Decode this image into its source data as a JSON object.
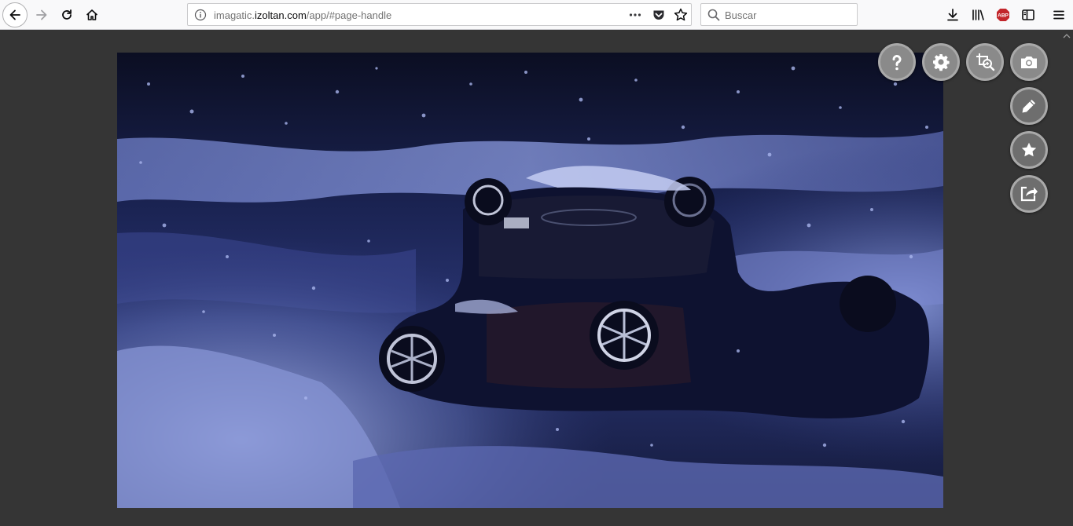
{
  "browser": {
    "url_prefix": "imagatic.",
    "url_domain": "izoltan.com",
    "url_path": "/app/#page-handle",
    "search_placeholder": "Buscar",
    "abp_label": "ABP"
  },
  "icons": {
    "back": "back-arrow-icon",
    "forward": "forward-arrow-icon",
    "reload": "reload-icon",
    "home": "home-icon",
    "info": "info-icon",
    "more": "more-dots-icon",
    "pocket": "pocket-icon",
    "star": "bookmark-star-icon",
    "search": "search-icon",
    "download": "download-icon",
    "library": "library-icon",
    "adblock": "adblock-icon",
    "sidebar": "sidebar-icon",
    "menu": "hamburger-menu-icon"
  },
  "photo": {
    "description_alt": "Upside-down toy car in snow at night"
  },
  "actions": [
    "help",
    "settings",
    "crop-zoom",
    "screenshot",
    "edit",
    "favorite",
    "share"
  ],
  "colors": {
    "page_background": "#353535",
    "fab_background": "#8a8a8a",
    "toolbar_background": "#f9f9fa"
  }
}
